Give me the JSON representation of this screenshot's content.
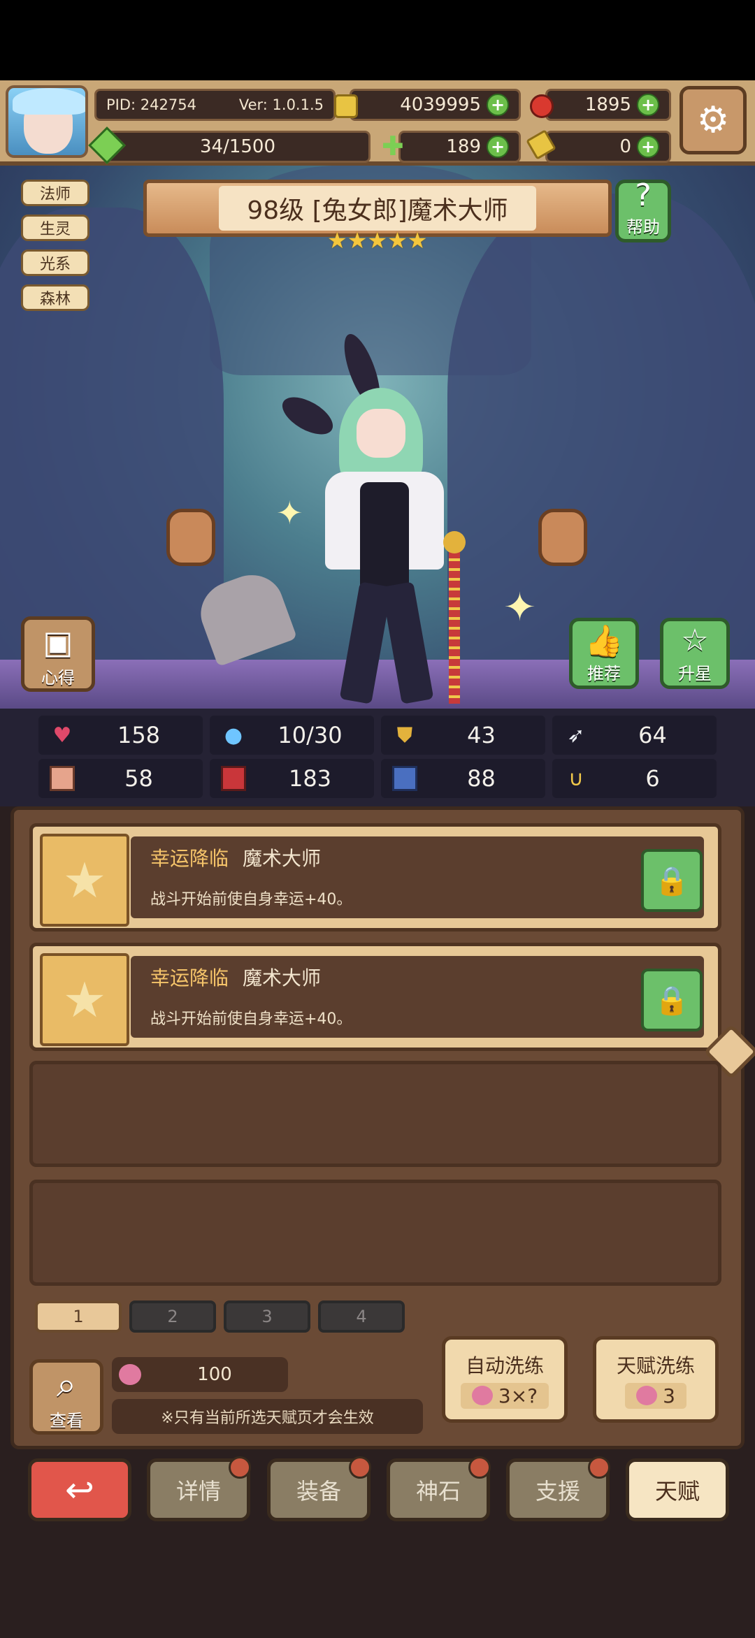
{
  "header": {
    "pid": "PID: 242754",
    "version": "Ver: 1.0.1.5",
    "gold": "4039995",
    "gems": "1895",
    "stamina": "34/1500",
    "clover": "189",
    "keys": "0"
  },
  "tags": [
    "法师",
    "生灵",
    "光系",
    "森林"
  ],
  "character": {
    "title": "98级 [兔女郎]魔术大师",
    "stars": "★★★★★"
  },
  "buttons": {
    "help": "帮助",
    "insight": "心得",
    "recommend": "推荐",
    "star_up": "升星",
    "view": "查看"
  },
  "stats": {
    "hp": "158",
    "mana": "10/30",
    "defense": "43",
    "speed": "64",
    "stat5": "58",
    "stat6": "183",
    "stat7": "88",
    "stat8": "6"
  },
  "talents": [
    {
      "name": "幸运降临",
      "source": "魔术大师",
      "desc": "战斗开始前使自身幸运+40。"
    },
    {
      "name": "幸运降临",
      "source": "魔术大师",
      "desc": "战斗开始前使自身幸运+40。"
    }
  ],
  "pages": [
    "1",
    "2",
    "3",
    "4"
  ],
  "reroll": {
    "cost_value": "100",
    "note": "※只有当前所选天赋页才会生效",
    "auto_label": "自动洗练",
    "auto_cost": "3×?",
    "talent_label": "天赋洗练",
    "talent_cost": "3"
  },
  "nav": {
    "details": "详情",
    "equipment": "装备",
    "god_stone": "神石",
    "support": "支援",
    "talent": "天赋"
  },
  "colors": {
    "accent_green": "#6cc06a",
    "back_red": "#e1564b",
    "gold_text": "#f5c46a"
  }
}
